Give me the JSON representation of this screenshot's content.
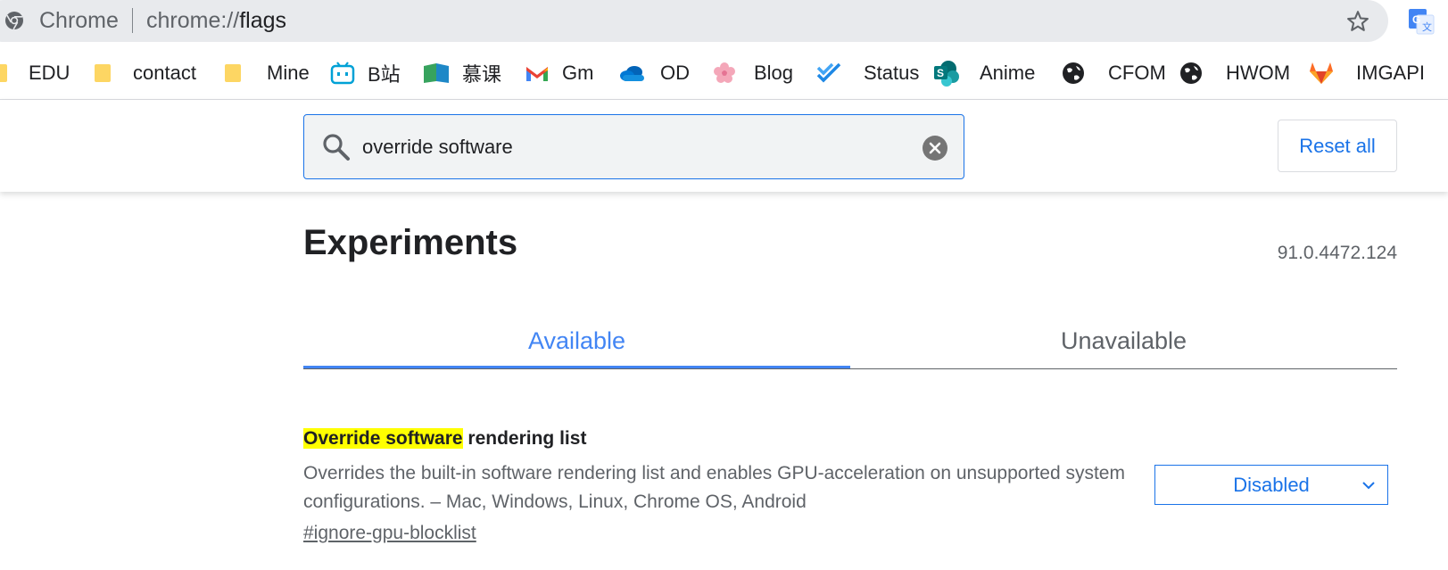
{
  "omnibox": {
    "site_label": "Chrome",
    "url_scheme": "chrome://",
    "url_host": "flags"
  },
  "bookmarks": [
    {
      "label": "EDU",
      "icon": "folder-icon"
    },
    {
      "label": "contact",
      "icon": "folder-icon"
    },
    {
      "label": "Mine",
      "icon": "folder-icon"
    },
    {
      "label": "B站",
      "icon": "bilibili-icon"
    },
    {
      "label": "慕课",
      "icon": "mooc-icon"
    },
    {
      "label": "Gm",
      "icon": "gmail-icon"
    },
    {
      "label": "OD",
      "icon": "onedrive-icon"
    },
    {
      "label": "Blog",
      "icon": "flower-icon"
    },
    {
      "label": "Status",
      "icon": "status-icon"
    },
    {
      "label": "Anime",
      "icon": "sharepoint-icon"
    },
    {
      "label": "CFOM",
      "icon": "globe-icon"
    },
    {
      "label": "HWOM",
      "icon": "globe-icon"
    },
    {
      "label": "IMGAPI",
      "icon": "gitlab-icon"
    }
  ],
  "search": {
    "value": "override software",
    "reset_label": "Reset all"
  },
  "page": {
    "title": "Experiments",
    "version": "91.0.4472.124",
    "tabs": [
      {
        "label": "Available",
        "active": true
      },
      {
        "label": "Unavailable",
        "active": false
      }
    ]
  },
  "flag": {
    "title_highlight": "Override software",
    "title_rest": " rendering list",
    "description": "Overrides the built-in software rendering list and enables GPU-acceleration on unsupported system configurations. – Mac, Windows, Linux, Chrome OS, Android",
    "link": "#ignore-gpu-blocklist",
    "state": "Disabled"
  },
  "colors": {
    "accent": "#1a73e8",
    "tab_active": "#4285f4",
    "highlight": "#ffff00"
  }
}
